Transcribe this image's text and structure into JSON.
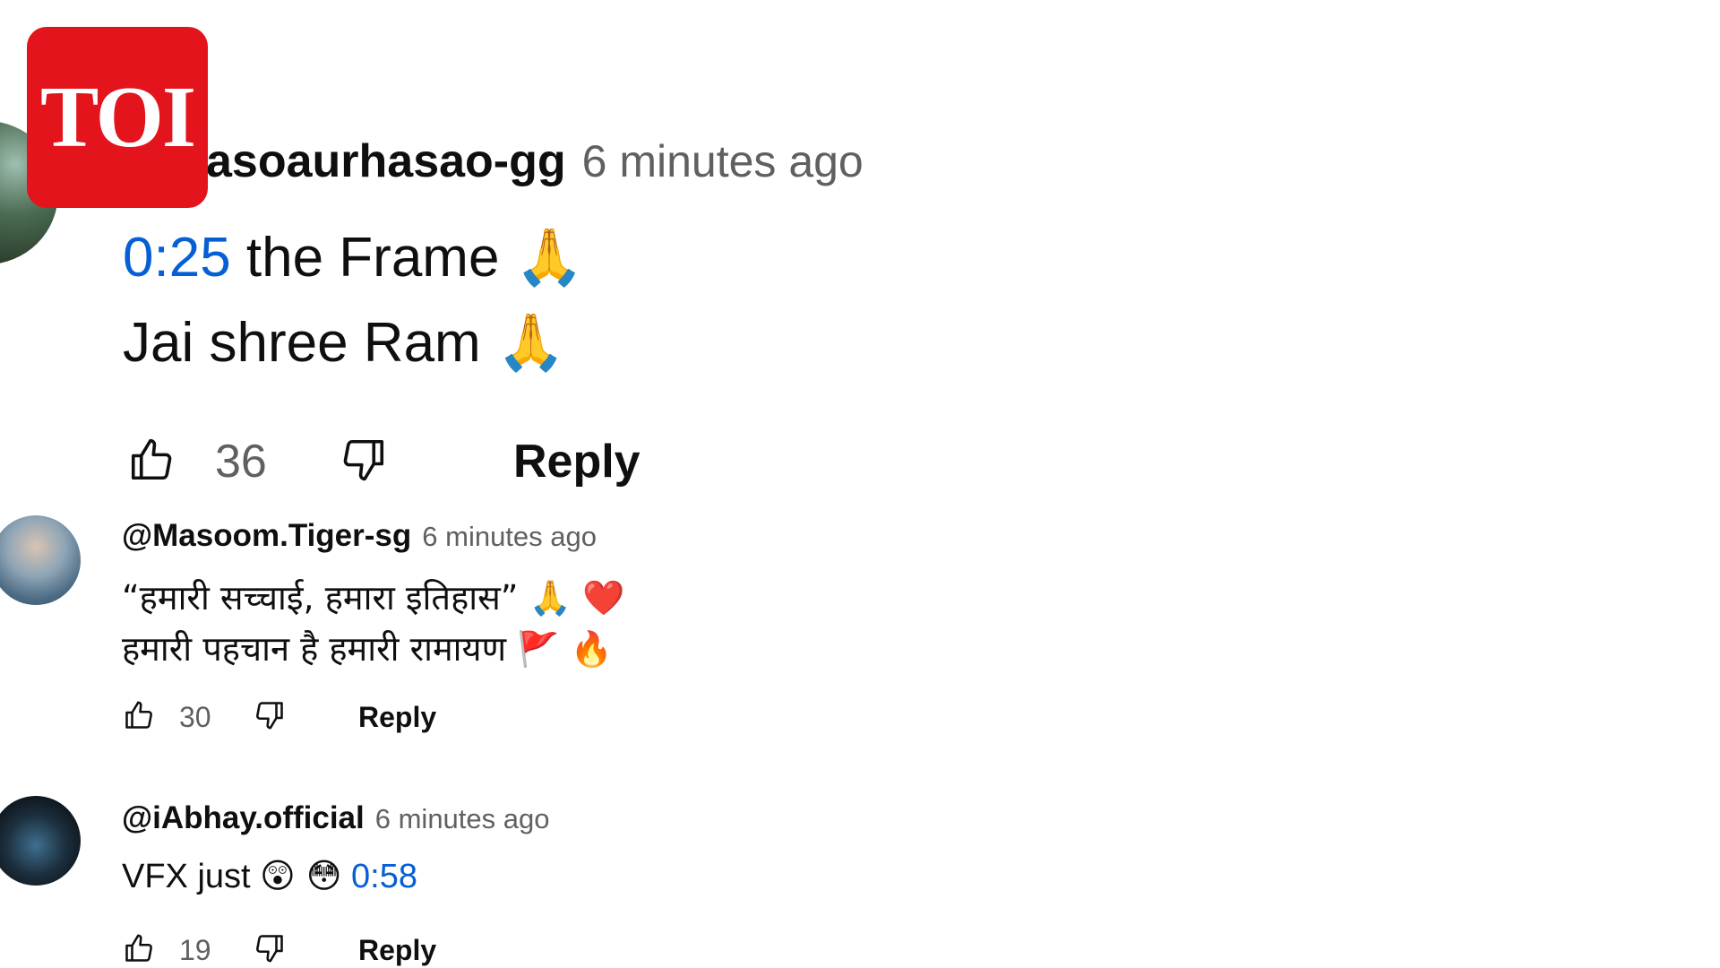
{
  "overlay": {
    "logo_text": "TOI"
  },
  "comments": [
    {
      "handle": "asoaurhasao-gg",
      "time": "6 minutes ago",
      "lines": [
        {
          "timestamp": "0:25",
          "text": " the Frame ",
          "emoji": "🙏"
        },
        {
          "text": "Jai shree Ram ",
          "emoji": "🙏"
        }
      ],
      "like_count": "36",
      "reply_label": "Reply"
    },
    {
      "handle": "@Masoom.Tiger-sg",
      "time": "6 minutes ago",
      "lines": [
        {
          "text": "“हमारी सच्चाई, हमारा इतिहास” ",
          "emoji": "🙏 ❤️"
        },
        {
          "text": "हमारी पहचान है हमारी रामायण ",
          "emoji": "🚩 🔥"
        }
      ],
      "like_count": "30",
      "reply_label": "Reply"
    },
    {
      "handle": "@iAbhay.official",
      "time": "6 minutes ago",
      "lines": [
        {
          "text": "VFX just ",
          "emoji": "😲 😳",
          "timestamp": "0:58"
        }
      ],
      "like_count": "19",
      "reply_label": "Reply"
    }
  ],
  "colors": {
    "timestamp_link": "#065fd4",
    "logo_bg": "#e3141b",
    "secondary_text": "#606060"
  },
  "icons": [
    "like-icon",
    "dislike-icon"
  ]
}
